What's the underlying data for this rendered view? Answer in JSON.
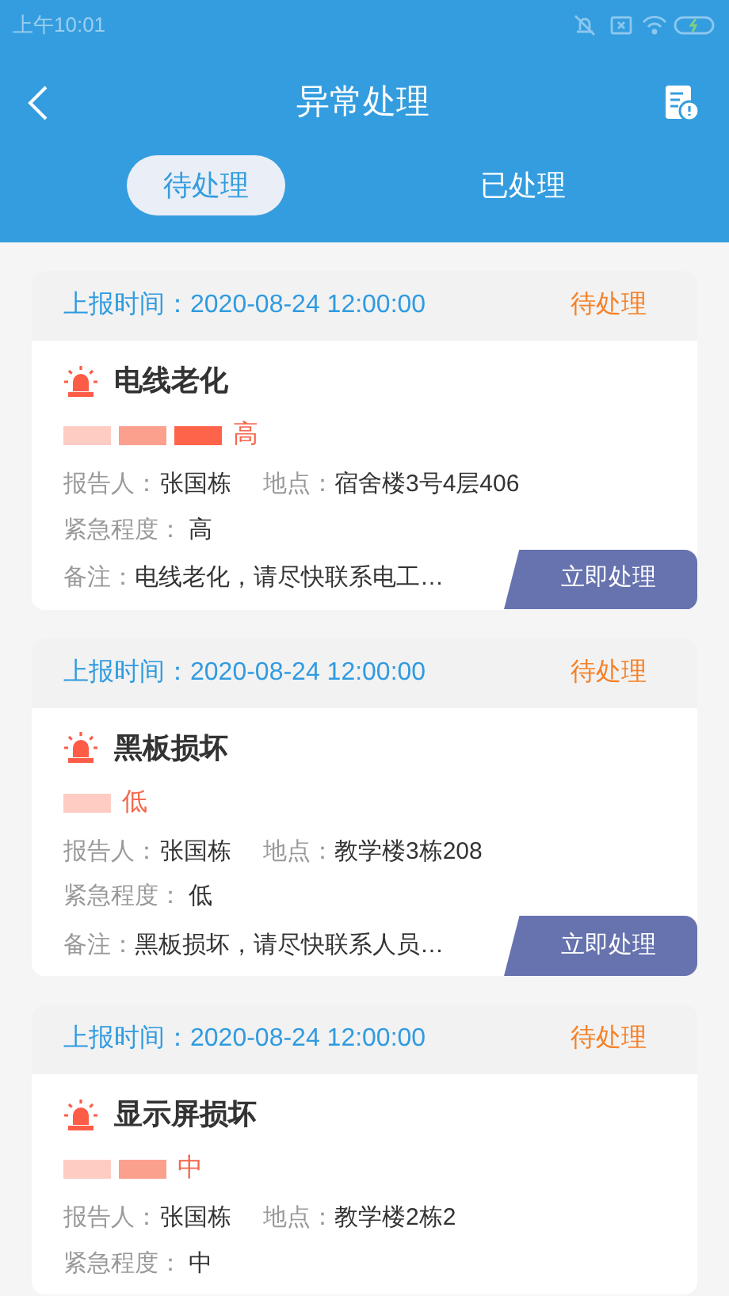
{
  "status_bar": {
    "time": "上午10:01"
  },
  "header": {
    "title": "异常处理"
  },
  "tabs": [
    {
      "label": "待处理",
      "selected": true
    },
    {
      "label": "已处理",
      "selected": false
    }
  ],
  "reports": [
    {
      "reported_label": "上报时间：",
      "reported_time": "2020-08-24 12:00:00",
      "status": "待处理",
      "title": "电线老化",
      "urgency": {
        "segments": [
          {
            "on": true
          },
          {
            "on": true
          },
          {
            "on": true
          }
        ],
        "label": "高"
      },
      "reporter_label": "报告人：",
      "reporter": "张国栋",
      "location_label": "地点：",
      "location": "宿舍楼3号4层406",
      "urgency_label": "紧急程度：",
      "urgency_value": "高",
      "note_label": "备注：",
      "note": "电线老化，请尽快联系电工…",
      "action": "立即处理"
    },
    {
      "reported_label": "上报时间：",
      "reported_time": "2020-08-24 12:00:00",
      "status": "待处理",
      "title": "黑板损坏",
      "urgency": {
        "segments": [
          {
            "on": true
          },
          {
            "on": false
          },
          {
            "on": false
          }
        ],
        "label": "低"
      },
      "reporter_label": "报告人：",
      "reporter": "张国栋",
      "location_label": "地点：",
      "location": "教学楼3栋208",
      "urgency_label": "紧急程度：",
      "urgency_value": "低",
      "note_label": "备注：",
      "note": "黑板损坏，请尽快联系人员…",
      "action": "立即处理"
    },
    {
      "reported_label": "上报时间：",
      "reported_time": "2020-08-24 12:00:00",
      "status": "待处理",
      "title": "显示屏损坏",
      "urgency": {
        "segments": [
          {
            "on": true
          },
          {
            "on": true
          },
          {
            "on": false
          }
        ],
        "label": "中"
      },
      "reporter_label": "报告人：",
      "reporter": "张国栋",
      "location_label": "地点：",
      "location": "教学楼2栋2",
      "urgency_label": "紧急程度：",
      "urgency_value": "中"
    }
  ]
}
